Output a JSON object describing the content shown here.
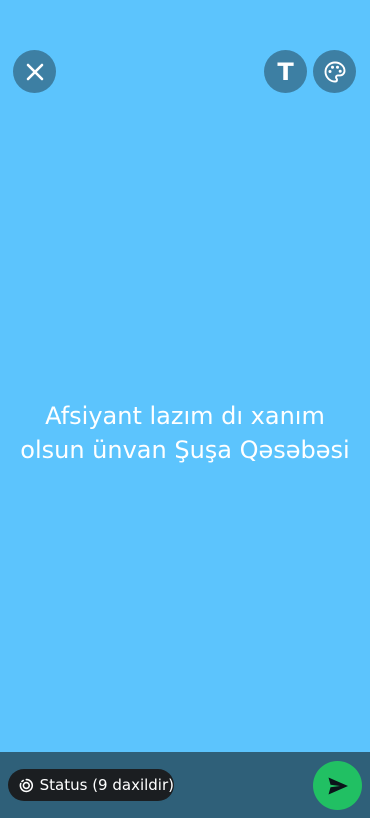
{
  "colors": {
    "background": "#5cc4fd",
    "toolbar_button": "#3d7fa3",
    "bottom_bar": "#2f6079",
    "chip": "#1b1e21",
    "send": "#21c063"
  },
  "toolbar": {
    "close_icon": "close-icon",
    "text_button_label": "T",
    "palette_icon": "palette-icon"
  },
  "status": {
    "text": "Afsiyant lazım dı xanım\nolsun ünvan Şuşa Qəsəbəsi"
  },
  "footer": {
    "audience_icon": "status-ring-icon",
    "audience_label": "Status (9 daxildir)",
    "send_icon": "send-icon"
  }
}
